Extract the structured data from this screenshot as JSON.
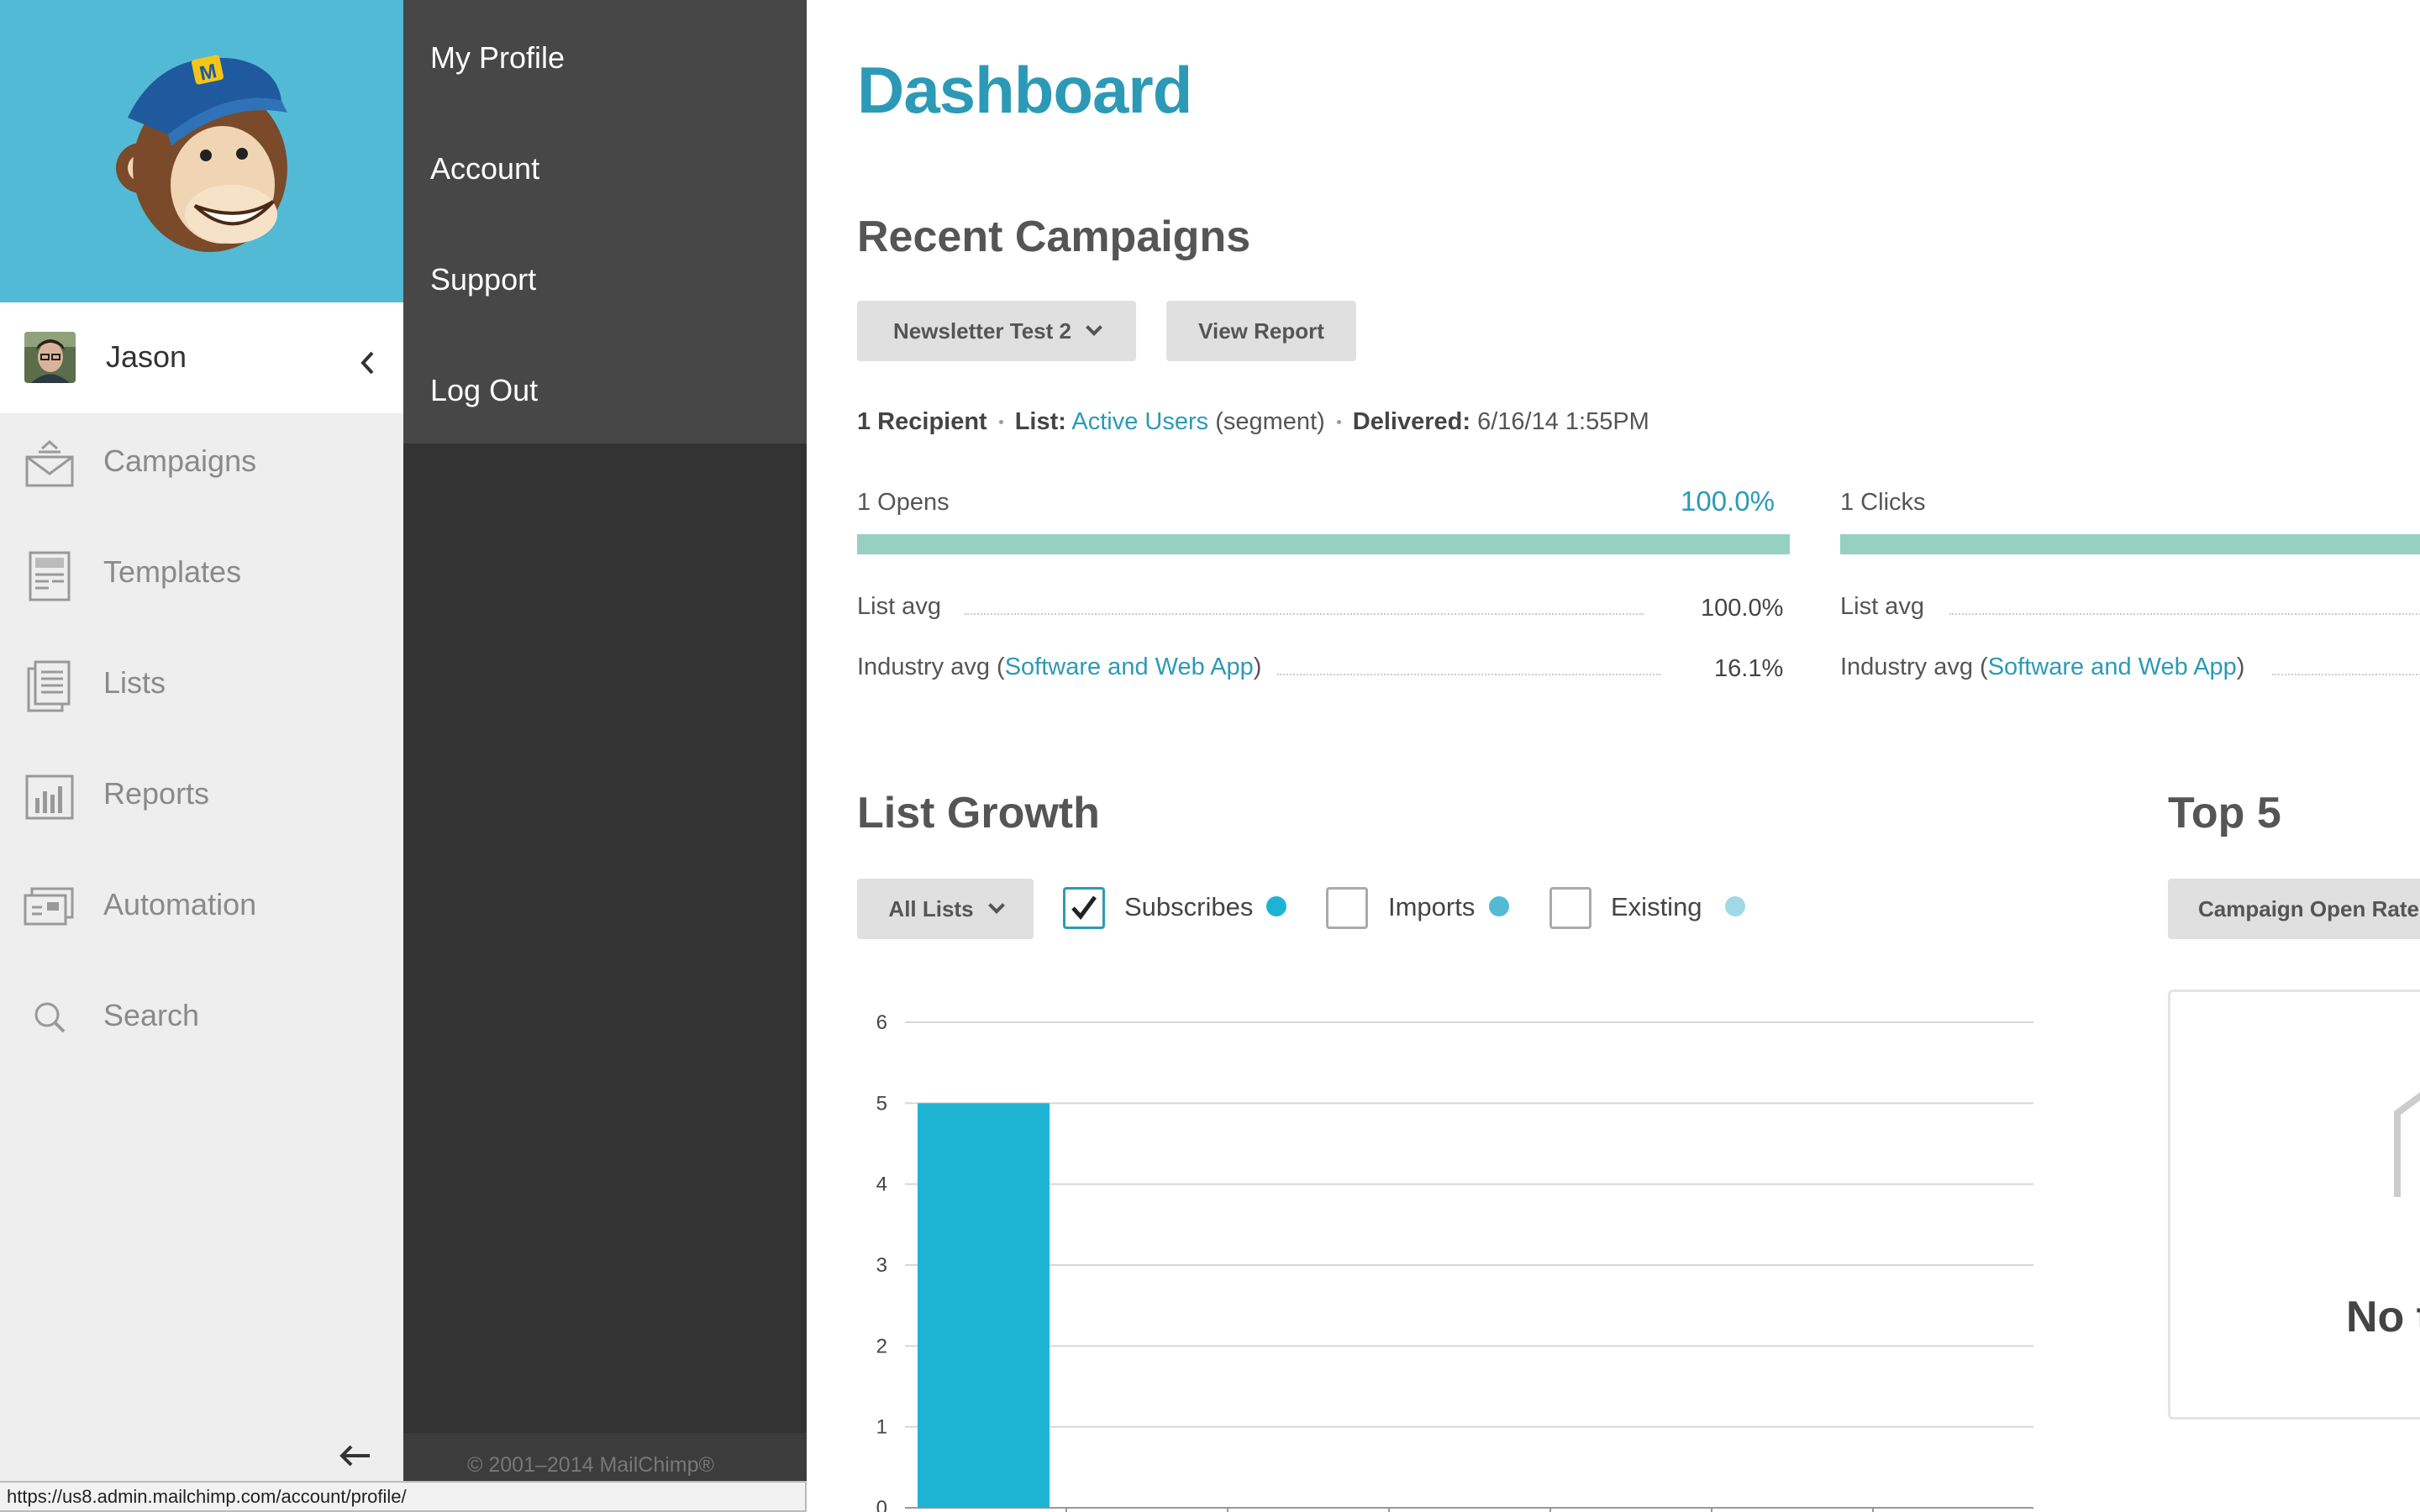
{
  "user": {
    "name": "Jason"
  },
  "nav": {
    "items": [
      {
        "label": "Campaigns",
        "icon": "envelope-icon"
      },
      {
        "label": "Templates",
        "icon": "template-icon"
      },
      {
        "label": "Lists",
        "icon": "list-icon"
      },
      {
        "label": "Reports",
        "icon": "bar-chart-icon"
      },
      {
        "label": "Automation",
        "icon": "automation-icon"
      },
      {
        "label": "Search",
        "icon": "search-icon"
      }
    ]
  },
  "account_menu": {
    "items": [
      "My Profile",
      "Account",
      "Support",
      "Log Out"
    ],
    "copyright": "© 2001–2014 MailChimp®"
  },
  "main": {
    "title": "Dashboard",
    "recent": {
      "title": "Recent Campaigns",
      "campaign_select": "Newsletter Test 2",
      "view_report": "View Report",
      "recipients": "1 Recipient",
      "list_label": "List:",
      "list_name": "Active Users",
      "segment": "(segment)",
      "delivered_label": "Delivered:",
      "delivered_value": "6/16/14 1:55PM",
      "opens": {
        "label": "1 Opens",
        "pct": "100.0%",
        "fill": 1.0,
        "list_avg_label": "List avg",
        "list_avg_value": "100.0%",
        "industry_label": "Industry avg (",
        "industry_link": "Software and Web App",
        "industry_close": ")",
        "industry_value": "16.1%"
      },
      "clicks": {
        "label": "1 Clicks",
        "fill": 1.0,
        "list_avg_label": "List avg",
        "industry_label": "Industry avg (",
        "industry_link": "Software and Web App",
        "industry_close": ")"
      }
    },
    "growth": {
      "title": "List Growth",
      "list_select": "All Lists",
      "toggles": [
        {
          "label": "Subscribes",
          "checked": true,
          "color": "#1db4d4"
        },
        {
          "label": "Imports",
          "checked": false,
          "color": "#52bad5"
        },
        {
          "label": "Existing",
          "checked": false,
          "color": "#9fd9e6"
        }
      ]
    },
    "top5": {
      "title": "Top 5",
      "select": "Campaign Open Rate",
      "empty_text": "No t"
    }
  },
  "chart_data": {
    "type": "bar",
    "y_ticks": [
      "0",
      "1",
      "2",
      "3",
      "4",
      "5",
      "6"
    ],
    "ylim": [
      0,
      6
    ],
    "series": [
      {
        "values": [
          5,
          0,
          0,
          0,
          0,
          0,
          0
        ]
      }
    ],
    "bar_color": "#1db4d4"
  },
  "status_url": "https://us8.admin.mailchimp.com/account/profile/"
}
